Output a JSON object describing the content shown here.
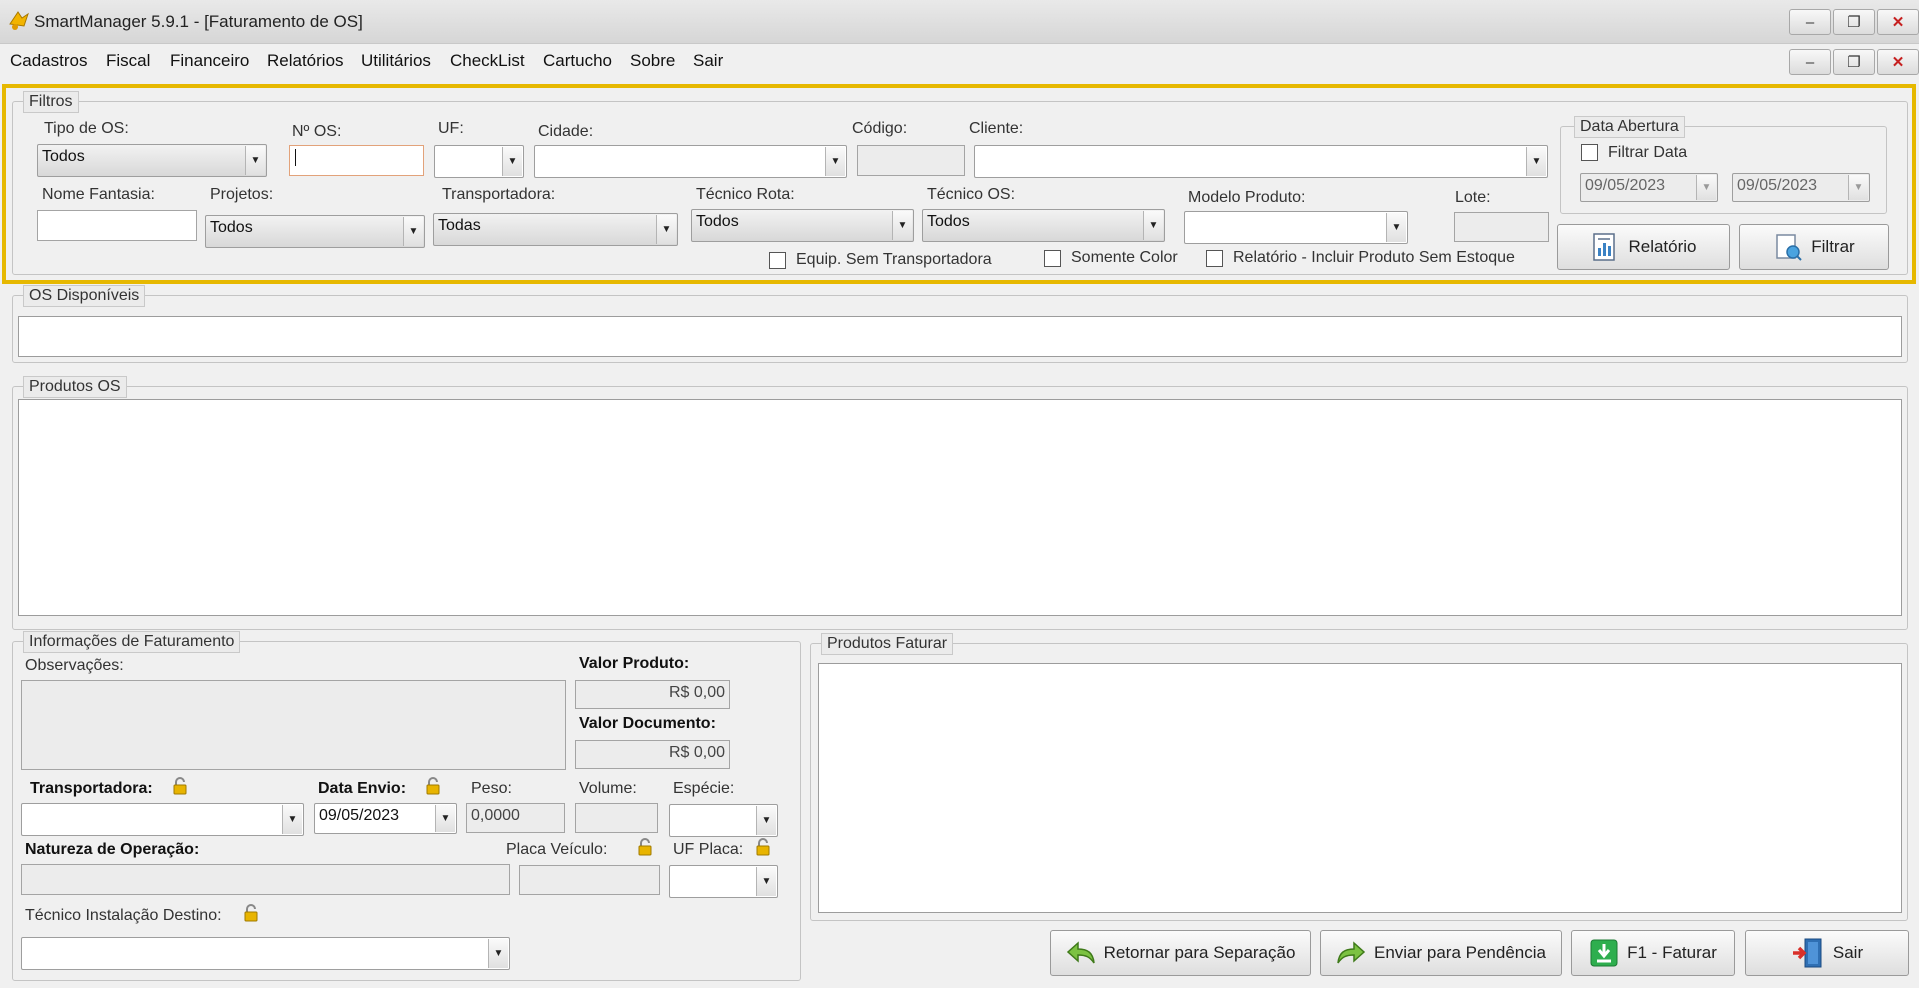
{
  "window": {
    "title": "SmartManager 5.9.1 - [Faturamento de OS]"
  },
  "menu": {
    "items": [
      "Cadastros",
      "Fiscal",
      "Financeiro",
      "Relatórios",
      "Utilitários",
      "CheckList",
      "Cartucho",
      "Sobre",
      "Sair"
    ]
  },
  "filtros": {
    "legend": "Filtros",
    "tipo_os": {
      "label": "Tipo de OS:",
      "value": "Todos"
    },
    "num_os": {
      "label": "Nº OS:",
      "value": ""
    },
    "uf": {
      "label": "UF:",
      "value": ""
    },
    "cidade": {
      "label": "Cidade:",
      "value": ""
    },
    "codigo": {
      "label": "Código:",
      "value": ""
    },
    "cliente": {
      "label": "Cliente:",
      "value": ""
    },
    "nome_fantasia": {
      "label": "Nome Fantasia:",
      "value": ""
    },
    "projetos": {
      "label": "Projetos:",
      "value": "Todos"
    },
    "transportadora": {
      "label": "Transportadora:",
      "value": "Todas"
    },
    "tecnico_rota": {
      "label": "Técnico Rota:",
      "value": "Todos"
    },
    "tecnico_os": {
      "label": "Técnico OS:",
      "value": "Todos"
    },
    "modelo_produto": {
      "label": "Modelo Produto:",
      "value": ""
    },
    "lote": {
      "label": "Lote:",
      "value": ""
    },
    "equip_sem_transportadora": {
      "label": "Equip. Sem Transportadora",
      "checked": false
    },
    "somente_color": {
      "label": "Somente Color",
      "checked": false
    },
    "incluir_sem_estoque": {
      "label": "Relatório - Incluir Produto Sem Estoque",
      "checked": false
    },
    "data_abertura": {
      "legend": "Data Abertura",
      "filtrar_label": "Filtrar Data",
      "filtrar_checked": false,
      "de": "09/05/2023",
      "ate": "09/05/2023"
    },
    "relatorio_label": "Relatório",
    "filtrar_label": "Filtrar"
  },
  "os_disponiveis": {
    "legend": "OS Disponíveis"
  },
  "produtos_os": {
    "legend": "Produtos OS"
  },
  "info_faturamento": {
    "legend": "Informações de Faturamento",
    "observacoes_label": "Observações:",
    "observacoes_value": "",
    "valor_produto_label": "Valor Produto:",
    "valor_produto": "R$ 0,00",
    "valor_documento_label": "Valor Documento:",
    "valor_documento": "R$ 0,00",
    "transportadora_label": "Transportadora:",
    "transportadora_value": "",
    "data_envio_label": "Data Envio:",
    "data_envio": "09/05/2023",
    "peso_label": "Peso:",
    "peso": "0,0000",
    "volume_label": "Volume:",
    "volume": "",
    "especie_label": "Espécie:",
    "especie": "",
    "natureza_label": "Natureza de Operação:",
    "natureza_value": "",
    "placa_label": "Placa Veículo:",
    "placa": "",
    "uf_placa_label": "UF Placa:",
    "uf_placa": "",
    "tecnico_instalacao_label": "Técnico Instalação Destino:",
    "tecnico_instalacao_value": ""
  },
  "produtos_faturar": {
    "legend": "Produtos Faturar"
  },
  "actions": {
    "retornar": "Retornar para Separação",
    "enviar": "Enviar para Pendência",
    "faturar": "F1 - Faturar",
    "sair": "Sair"
  }
}
